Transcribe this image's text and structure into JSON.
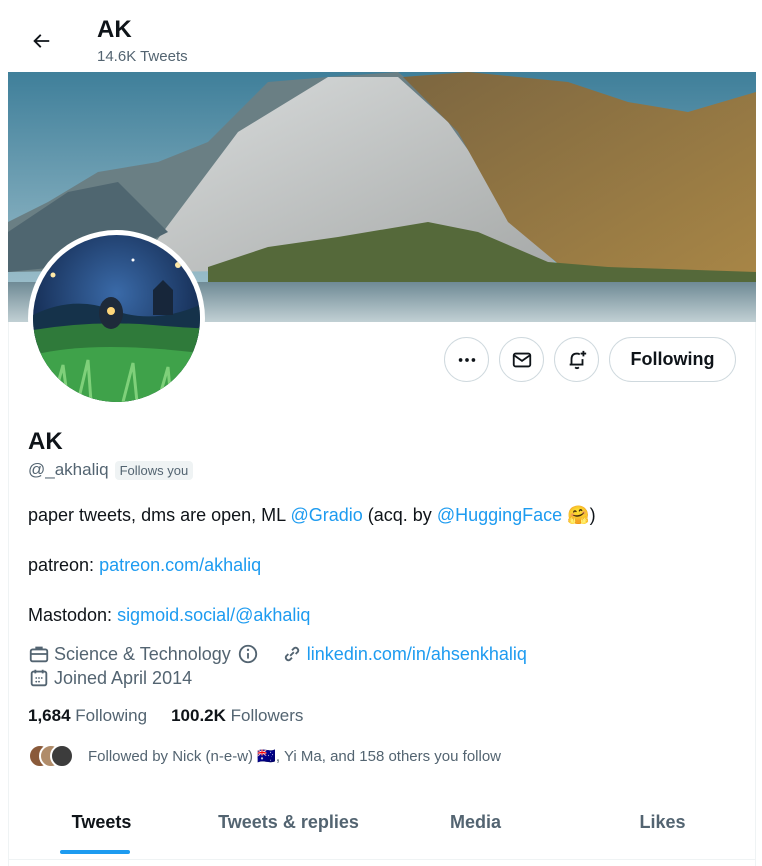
{
  "header": {
    "name": "AK",
    "tweet_count": "14.6K Tweets"
  },
  "actions": {
    "follow_label": "Following"
  },
  "profile": {
    "name": "AK",
    "handle": "@_akhaliq",
    "follows_you": "Follows you",
    "bio": {
      "line1_prefix": "paper tweets, dms are open, ML ",
      "line1_link1": "@Gradio",
      "line1_mid": " (acq. by ",
      "line1_link2": "@HuggingFace",
      "line1_emoji": "🤗",
      "line1_suffix": ")",
      "line2_prefix": "patreon: ",
      "line2_link": "patreon.com/akhaliq",
      "line3_prefix": "Mastodon: ",
      "line3_link": "sigmoid.social/@akhaliq"
    },
    "category": "Science & Technology",
    "website": "linkedin.com/in/ahsenkhaliq",
    "joined": "Joined April 2014"
  },
  "stats": {
    "following_count": "1,684",
    "following_label": "Following",
    "followers_count": "100.2K",
    "followers_label": "Followers"
  },
  "followed_by": "Followed by Nick (n-e-w) 🇦🇺, Yi Ma, and 158 others you follow",
  "tabs": [
    {
      "label": "Tweets",
      "active": true
    },
    {
      "label": "Tweets & replies",
      "active": false
    },
    {
      "label": "Media",
      "active": false
    },
    {
      "label": "Likes",
      "active": false
    }
  ],
  "colors": {
    "accent": "#1d9bf0",
    "text": "#0f1419",
    "secondary": "#536471"
  }
}
